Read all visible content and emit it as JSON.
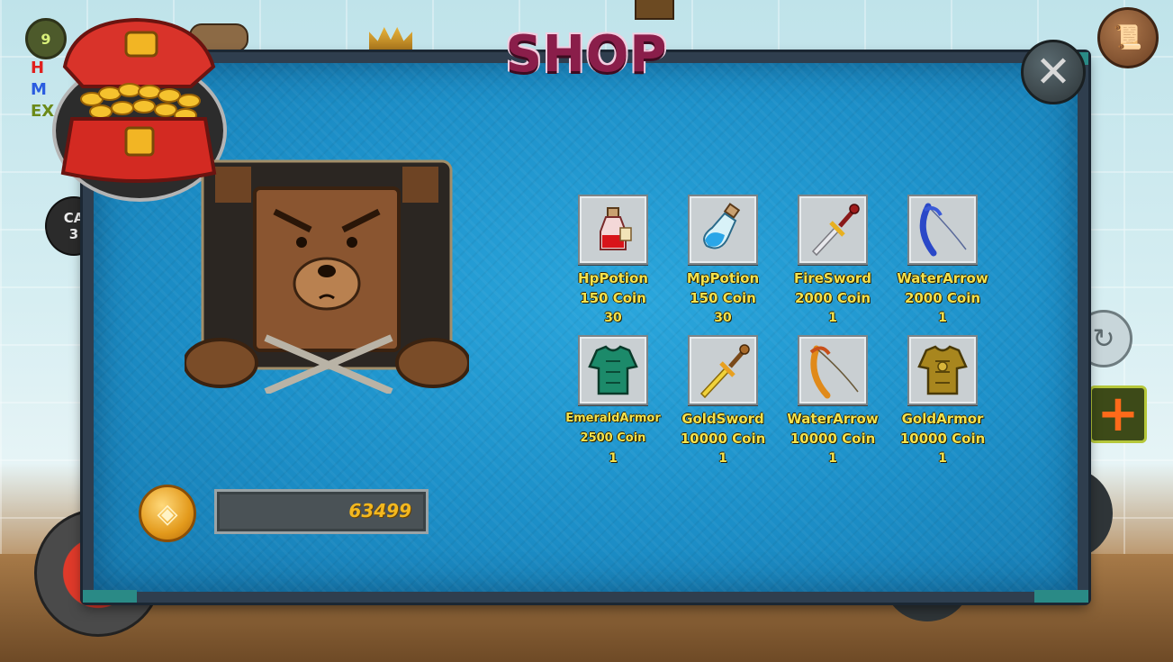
{
  "hud": {
    "level": "9",
    "camera_label": "CA",
    "camera_value": "3",
    "hp_letter": "H",
    "mp_letter": "M",
    "exp_letter": "EX"
  },
  "shop": {
    "title": "SHOP",
    "close_icon": "close-icon",
    "chest_icon": "treasure-chest-icon",
    "coin_balance": "63499",
    "items": [
      {
        "name": "HpPotion",
        "price": "150 Coin",
        "qty": "30",
        "icon": "hp-potion-icon"
      },
      {
        "name": "MpPotion",
        "price": "150 Coin",
        "qty": "30",
        "icon": "mp-potion-icon"
      },
      {
        "name": "FireSword",
        "price": "2000 Coin",
        "qty": "1",
        "icon": "fire-sword-icon"
      },
      {
        "name": "WaterArrow",
        "price": "2000 Coin",
        "qty": "1",
        "icon": "water-bow-icon"
      },
      {
        "name": "EmeraldArmor",
        "price": "2500 Coin",
        "qty": "1",
        "icon": "emerald-armor-icon"
      },
      {
        "name": "GoldSword",
        "price": "10000 Coin",
        "qty": "1",
        "icon": "gold-sword-icon"
      },
      {
        "name": "WaterArrow",
        "price": "10000 Coin",
        "qty": "1",
        "icon": "golden-bow-icon"
      },
      {
        "name": "GoldArmor",
        "price": "10000 Coin",
        "qty": "1",
        "icon": "gold-armor-icon"
      }
    ]
  },
  "colors": {
    "panel_blue": "#1c8fc8",
    "title": "#8a1e4a",
    "item_text": "#f4e24c",
    "coin_text": "#f3b81f"
  }
}
